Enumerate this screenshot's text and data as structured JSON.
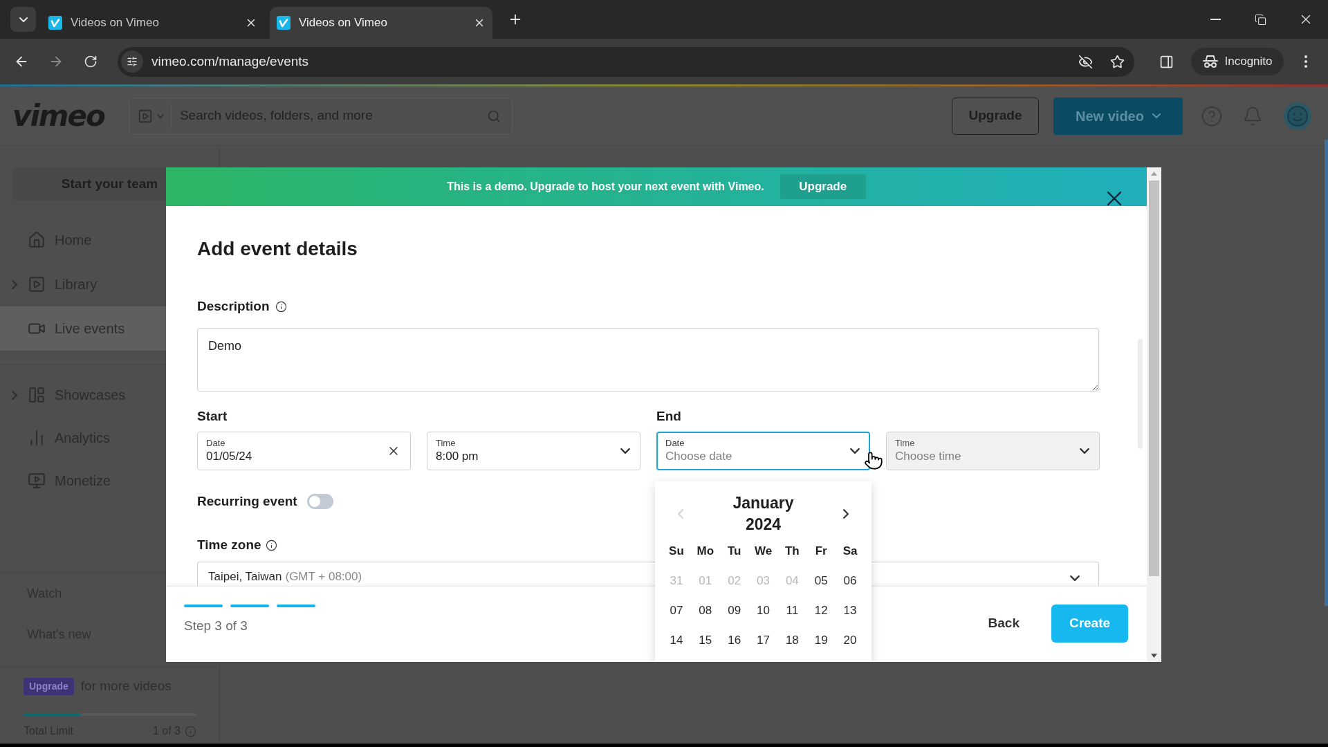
{
  "browser": {
    "tabs": [
      {
        "title": "Videos on Vimeo",
        "selected": false
      },
      {
        "title": "Videos on Vimeo",
        "selected": true
      }
    ],
    "url": "vimeo.com/manage/events",
    "profile": "Incognito"
  },
  "header": {
    "logo": "vimeo",
    "search_placeholder": "Search videos, folders, and more",
    "upgrade_button": "Upgrade",
    "new_video_button": "New video"
  },
  "sidebar": {
    "team_button": "Start your team",
    "nav_groups": [
      {
        "items": [
          {
            "label": "Home",
            "expandable": false,
            "selected": false
          },
          {
            "label": "Library",
            "expandable": true,
            "selected": false
          },
          {
            "label": "Live events",
            "expandable": false,
            "selected": true
          }
        ]
      },
      {
        "items": [
          {
            "label": "Showcases",
            "expandable": true,
            "selected": false
          },
          {
            "label": "Analytics",
            "expandable": false,
            "selected": false
          },
          {
            "label": "Monetize",
            "expandable": false,
            "selected": false
          }
        ]
      }
    ],
    "links": [
      {
        "label": "Watch"
      },
      {
        "label": "What's new"
      }
    ],
    "upgrade_badge": "Upgrade",
    "upgrade_text": "for more videos",
    "limit": {
      "label": "Total Limit",
      "count": "1 of 3",
      "level": 0.33
    }
  },
  "modal": {
    "banner": {
      "text": "This is a demo. Upgrade to host your next event with Vimeo.",
      "button": "Upgrade"
    },
    "title": "Add event details",
    "description": {
      "label": "Description",
      "value": "Demo"
    },
    "schedule": [
      {
        "label": "Start",
        "fields": [
          {
            "label": "Date",
            "value": "01/05/24",
            "clearable": true,
            "focused": false,
            "disabled": false
          },
          {
            "label": "Time",
            "value": "8:00 pm",
            "clearable": false,
            "focused": false,
            "disabled": false
          }
        ]
      },
      {
        "label": "End",
        "fields": [
          {
            "label": "Date",
            "placeholder": "Choose date",
            "clearable": false,
            "focused": true,
            "disabled": false
          },
          {
            "label": "Time",
            "placeholder": "Choose time",
            "clearable": false,
            "focused": false,
            "disabled": true
          }
        ]
      }
    ],
    "recurring": {
      "label": "Recurring event",
      "on": false
    },
    "timezone": {
      "label": "Time zone",
      "value": "Taipei, Taiwan",
      "offset": "(GMT + 08:00)"
    },
    "progress": {
      "steps": [
        {
          "done": true
        },
        {
          "done": true
        },
        {
          "done": true
        }
      ],
      "label": "Step 3 of 3"
    },
    "back_button": "Back",
    "create_button": "Create"
  },
  "date_picker": {
    "title": "January 2024",
    "prev_disabled": true,
    "next_disabled": false,
    "weekdays": [
      "Su",
      "Mo",
      "Tu",
      "We",
      "Th",
      "Fr",
      "Sa"
    ],
    "weeks": [
      [
        {
          "day": "31",
          "disabled": true
        },
        {
          "day": "01",
          "disabled": true
        },
        {
          "day": "02",
          "disabled": true
        },
        {
          "day": "03",
          "disabled": true
        },
        {
          "day": "04",
          "disabled": true
        },
        {
          "day": "05",
          "disabled": false
        },
        {
          "day": "06",
          "disabled": false
        }
      ],
      [
        {
          "day": "07",
          "disabled": false
        },
        {
          "day": "08",
          "disabled": false
        },
        {
          "day": "09",
          "disabled": false
        },
        {
          "day": "10",
          "disabled": false
        },
        {
          "day": "11",
          "disabled": false
        },
        {
          "day": "12",
          "disabled": false
        },
        {
          "day": "13",
          "disabled": false
        }
      ],
      [
        {
          "day": "14",
          "disabled": false
        },
        {
          "day": "15",
          "disabled": false
        },
        {
          "day": "16",
          "disabled": false
        },
        {
          "day": "17",
          "disabled": false
        },
        {
          "day": "18",
          "disabled": false
        },
        {
          "day": "19",
          "disabled": false
        },
        {
          "day": "20",
          "disabled": false
        }
      ]
    ]
  }
}
